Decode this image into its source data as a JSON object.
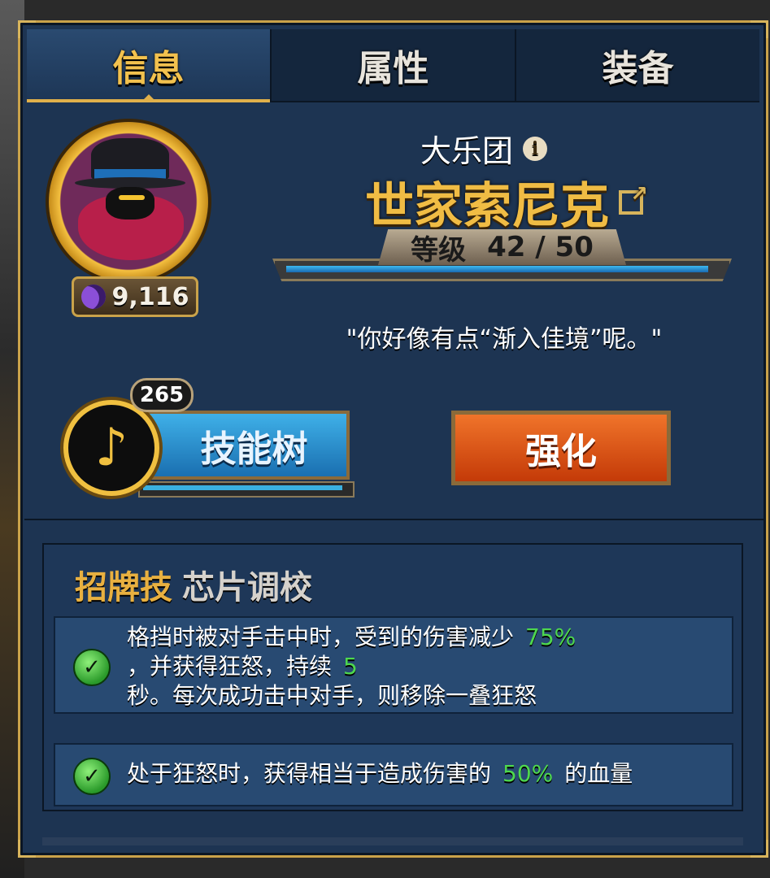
{
  "tabs": [
    {
      "label": "信息",
      "active": true
    },
    {
      "label": "属性",
      "active": false
    },
    {
      "label": "装备",
      "active": false
    }
  ],
  "hero": {
    "team": "大乐团",
    "name": "世家索尼克",
    "power": "9,116",
    "level_label": "等级",
    "level_current": "42",
    "level_separator": "/",
    "level_max": "50",
    "level_progress": 0.98,
    "quote": "\"你好像有点“渐入佳境”呢。\""
  },
  "actions": {
    "skill_tree_label": "技能树",
    "skill_points": "265",
    "skill_progress": 0.98,
    "enhance_label": "强化"
  },
  "signature": {
    "title": "招牌技",
    "name": "芯片调校",
    "abilities": [
      {
        "line1": "格挡时被对手击中时，受到的伤害减少",
        "value1": "75%",
        "line2": "，并获得狂怒，持续",
        "value2": "5",
        "line3": "秒。每次成功击中对手，则移除一叠狂怒"
      },
      {
        "prefix": "处于狂怒时，获得相当于造成伤害的",
        "value": "50%",
        "suffix": "的血量"
      }
    ]
  },
  "colors": {
    "gold": "#f0bc44",
    "panel": "#1d3452",
    "green_value": "#4ed84e"
  },
  "icons": {
    "power": "moon-icon",
    "info": "info-icon",
    "external": "external-link-icon",
    "skill": "music-note-icon",
    "check": "check-icon"
  }
}
